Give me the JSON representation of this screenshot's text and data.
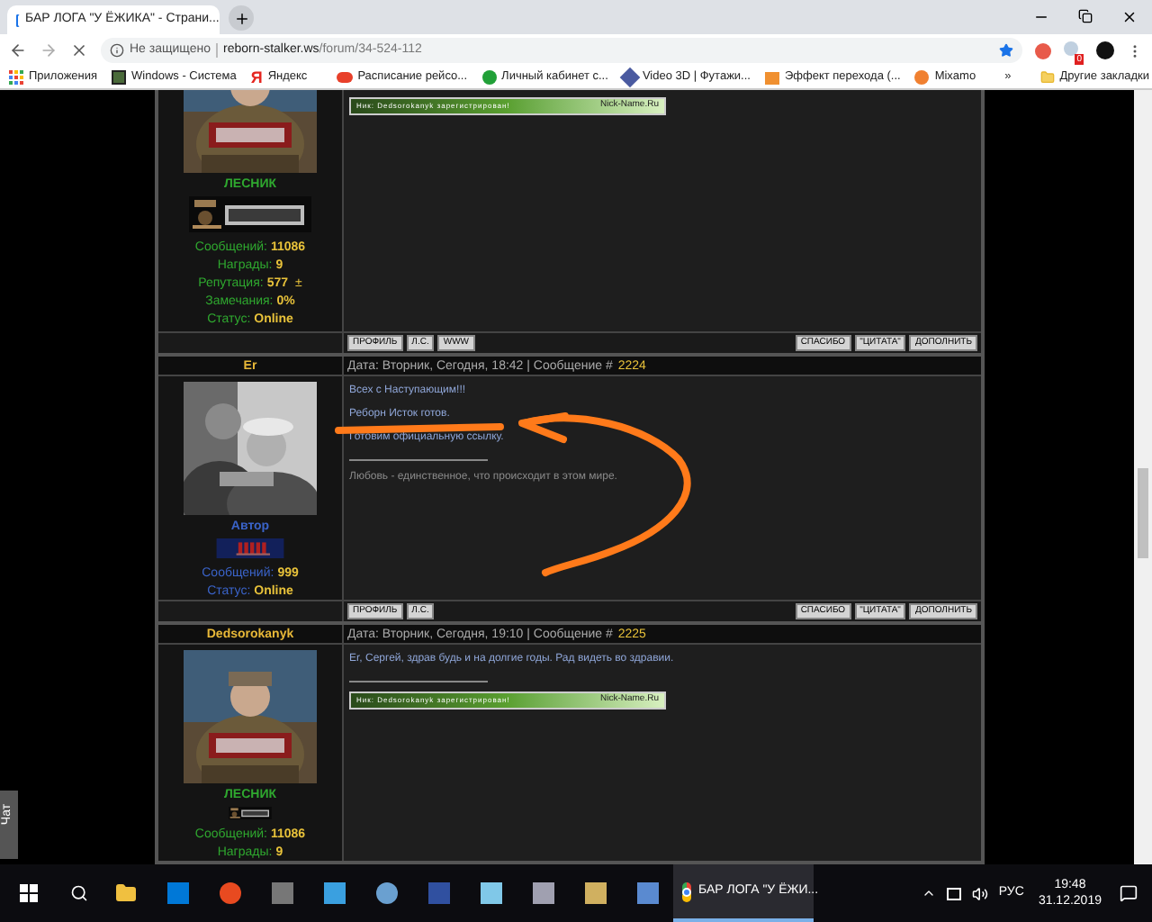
{
  "browser": {
    "tab_title": "БАР ЛОГА \"У ЁЖИКА\" - Страни...",
    "security": "Не защищено",
    "url_host": "reborn-stalker.ws",
    "url_path": "/forum/34-524-112",
    "extension_badge": "0",
    "bookmarks": [
      {
        "label": "Приложения"
      },
      {
        "label": "Windows - Система"
      },
      {
        "label": "Яндекс",
        "glyph": "Я"
      },
      {
        "label": "Расписание рейсо..."
      },
      {
        "label": "Личный кабинет с..."
      },
      {
        "label": "Video 3D | Футажи..."
      },
      {
        "label": "Эффект перехода (..."
      },
      {
        "label": "Mixamo"
      }
    ],
    "more": "»",
    "other_bookmarks": "Другие закладки"
  },
  "chat_tab": "Чат",
  "posts": [
    {
      "kind": "forester",
      "color": "#2fa82f",
      "rank": "ЛЕСНИК",
      "stats": [
        {
          "label": "Сообщений:",
          "value": "11086"
        },
        {
          "label": "Награды:",
          "value": "9"
        },
        {
          "label": "Репутация:",
          "value": "577",
          "suffix": "±"
        },
        {
          "label": "Замечания:",
          "value": "0%"
        },
        {
          "label": "Статус:",
          "value": "Online"
        }
      ],
      "body": [
        {
          "kind": "userbar",
          "text": "Ник: Dedsorokanyk зарегистрирован!",
          "site": "Nick-Name.Ru"
        }
      ],
      "buttons_left": [
        "ПРОФИЛЬ",
        "Л.С.",
        "WWW"
      ],
      "buttons_right": [
        "СПАСИБО",
        "\"ЦИТАТА\"",
        "ДОПОЛНИТЬ"
      ]
    },
    {
      "kind": "author",
      "author": "Er",
      "date": "Дата: Вторник, Сегодня, 18:42 | Сообщение #",
      "number": "2224",
      "color": "#3a63c8",
      "rank": "Автор",
      "stats": [
        {
          "label": "Сообщений:",
          "value": "999"
        },
        {
          "label": "Статус:",
          "value": "Online"
        }
      ],
      "body": [
        {
          "kind": "text",
          "text": "Всех с Наступающим!!!"
        },
        {
          "kind": "text",
          "text": "Реборн Исток готов."
        },
        {
          "kind": "text",
          "text": "Готовим официальную ссылку."
        },
        {
          "kind": "rule"
        },
        {
          "kind": "signature",
          "text": "Любовь - единственное, что происходит в этом мире."
        }
      ],
      "buttons_left": [
        "ПРОФИЛЬ",
        "Л.С."
      ],
      "buttons_right": [
        "СПАСИБО",
        "\"ЦИТАТА\"",
        "ДОПОЛНИТЬ"
      ]
    },
    {
      "kind": "forester",
      "author": "Dedsorokanyk",
      "date": "Дата: Вторник, Сегодня, 19:10 | Сообщение #",
      "number": "2225",
      "color": "#2fa82f",
      "rank": "ЛЕСНИК",
      "stats": [
        {
          "label": "Сообщений:",
          "value": "11086"
        },
        {
          "label": "Награды:",
          "value": "9"
        }
      ],
      "body": [
        {
          "kind": "text",
          "text": "Er, Сергей, здрав будь и на долгие годы. Рад видеть во здравии."
        },
        {
          "kind": "rule"
        },
        {
          "kind": "userbar",
          "text": "Ник: Dedsorokanyk зарегистрирован!",
          "site": "Nick-Name.Ru"
        }
      ]
    }
  ],
  "taskbar": {
    "window_title": "БАР ЛОГА \"У ЁЖИ...",
    "language": "РУС",
    "time": "19:48",
    "date": "31.12.2019"
  }
}
